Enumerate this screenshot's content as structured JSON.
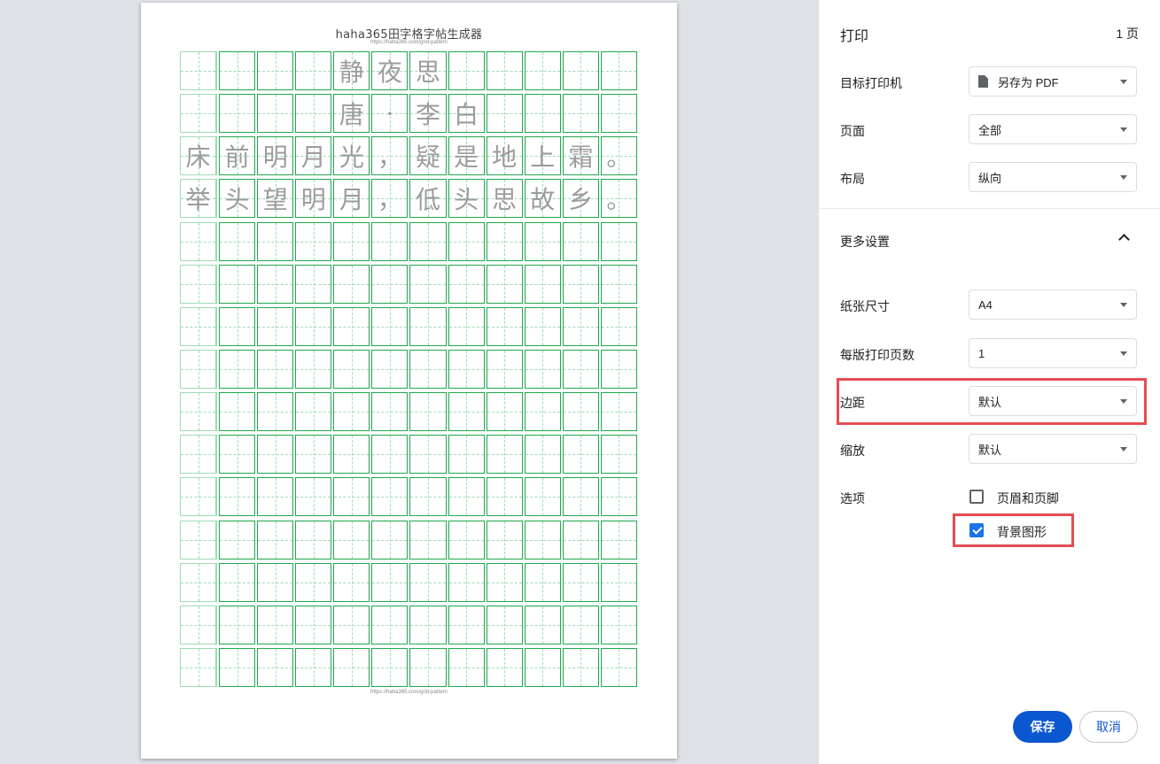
{
  "preview": {
    "doc_title": "haha365田字格字帖生成器",
    "doc_url_top": "https://haha365.com/grid-pattern",
    "doc_url_bottom": "https://haha365.com/grid-pattern",
    "grid_rows": [
      [
        "",
        "",
        "",
        "",
        "静",
        "夜",
        "思",
        "",
        "",
        "",
        "",
        ""
      ],
      [
        "",
        "",
        "",
        "",
        "唐",
        "·",
        "李",
        "白",
        "",
        "",
        "",
        ""
      ],
      [
        "床",
        "前",
        "明",
        "月",
        "光",
        "，",
        "疑",
        "是",
        "地",
        "上",
        "霜",
        "。"
      ],
      [
        "举",
        "头",
        "望",
        "明",
        "月",
        "，",
        "低",
        "头",
        "思",
        "故",
        "乡",
        "。"
      ],
      [
        "",
        "",
        "",
        "",
        "",
        "",
        "",
        "",
        "",
        "",
        "",
        ""
      ],
      [
        "",
        "",
        "",
        "",
        "",
        "",
        "",
        "",
        "",
        "",
        "",
        ""
      ],
      [
        "",
        "",
        "",
        "",
        "",
        "",
        "",
        "",
        "",
        "",
        "",
        ""
      ],
      [
        "",
        "",
        "",
        "",
        "",
        "",
        "",
        "",
        "",
        "",
        "",
        ""
      ],
      [
        "",
        "",
        "",
        "",
        "",
        "",
        "",
        "",
        "",
        "",
        "",
        ""
      ],
      [
        "",
        "",
        "",
        "",
        "",
        "",
        "",
        "",
        "",
        "",
        "",
        ""
      ],
      [
        "",
        "",
        "",
        "",
        "",
        "",
        "",
        "",
        "",
        "",
        "",
        ""
      ],
      [
        "",
        "",
        "",
        "",
        "",
        "",
        "",
        "",
        "",
        "",
        "",
        ""
      ],
      [
        "",
        "",
        "",
        "",
        "",
        "",
        "",
        "",
        "",
        "",
        "",
        ""
      ],
      [
        "",
        "",
        "",
        "",
        "",
        "",
        "",
        "",
        "",
        "",
        "",
        ""
      ],
      [
        "",
        "",
        "",
        "",
        "",
        "",
        "",
        "",
        "",
        "",
        "",
        ""
      ]
    ]
  },
  "panel": {
    "title": "打印",
    "page_count": "1 页",
    "destination": {
      "label": "目标打印机",
      "value": "另存为 PDF",
      "icon": "pdf-file-icon"
    },
    "pages": {
      "label": "页面",
      "value": "全部"
    },
    "layout": {
      "label": "布局",
      "value": "纵向"
    },
    "more_settings": "更多设置",
    "paper_size": {
      "label": "纸张尺寸",
      "value": "A4"
    },
    "pages_per_sheet": {
      "label": "每版打印页数",
      "value": "1"
    },
    "margins": {
      "label": "边距",
      "value": "默认"
    },
    "scale": {
      "label": "缩放",
      "value": "默认"
    },
    "options": {
      "label": "选项",
      "headers_footers": {
        "label": "页眉和页脚",
        "checked": false
      },
      "background_graphics": {
        "label": "背景图形",
        "checked": true
      }
    },
    "save_label": "保存",
    "cancel_label": "取消",
    "highlight_color": "#e54d53",
    "accent_color": "#0b57d0"
  }
}
